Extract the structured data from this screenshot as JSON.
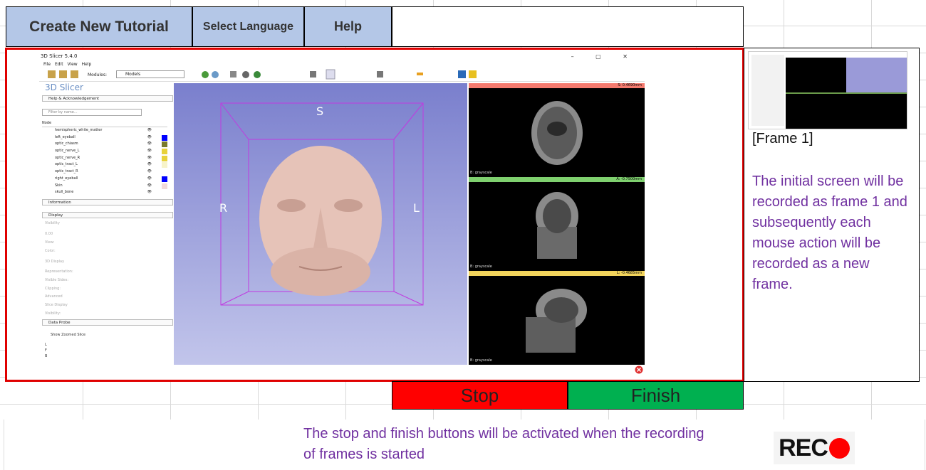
{
  "toolbar": {
    "create_label": "Create New Tutorial",
    "language_label": "Select Language",
    "help_label": "Help"
  },
  "controls": {
    "stop_label": "Stop",
    "finish_label": "Finish",
    "rec_label": "REC"
  },
  "side": {
    "frame_title": "[Frame 1]",
    "frame_description": "The initial screen will be recorded as frame 1 and subsequently each mouse action will be recorded as a new frame."
  },
  "bottom_note": "The stop and finish buttons will be activated when the recording of frames is started",
  "slicer": {
    "title": "3D Slicer 5.4.0",
    "menu": "File Edit View Help",
    "window_controls": "– ▢ ✕",
    "modules_label": "Modules:",
    "module_selected": "Models",
    "brand": "3D Slicer",
    "sections": {
      "help": "Help & Acknowledgement",
      "information": "Information",
      "display": "Display",
      "data_probe": "Data Probe"
    },
    "filter_placeholder": "Filter by name...",
    "node_header": "Node",
    "nodes": [
      {
        "name": "hemispheric_white_matter",
        "color": ""
      },
      {
        "name": "left_eyeball",
        "color": "#0000ff"
      },
      {
        "name": "optic_chiasm",
        "color": "#7a7a2a"
      },
      {
        "name": "optic_nerve_L",
        "color": "#e8d23a"
      },
      {
        "name": "optic_nerve_R",
        "color": "#e8d23a"
      },
      {
        "name": "optic_tract_L",
        "color": "#f7f3c9"
      },
      {
        "name": "optic_tract_R",
        "color": ""
      },
      {
        "name": "right_eyeball",
        "color": "#0000ff"
      },
      {
        "name": "Skin",
        "color": "#f2dada"
      },
      {
        "name": "skull_bone",
        "color": ""
      }
    ],
    "display_items": [
      "Visibility",
      "View:",
      "Color:",
      "3D Display",
      "Representation:",
      "Visible Sides:",
      "Clipping:",
      "Advanced",
      "Slice Display",
      "Visibility:"
    ],
    "opacity_value": "0.00",
    "show_zoomed_slice": "Show Zoomed Slice",
    "probe_letters": [
      "L",
      "F",
      "B"
    ],
    "orient": {
      "top": "S",
      "left": "R",
      "right": "L"
    },
    "slices": [
      {
        "bar": "S: 0.4690mm",
        "bar_color": "#f47a6e",
        "label": "B: grayscale"
      },
      {
        "bar": "A: -0.7500mm",
        "bar_color": "#7fd06f",
        "label": "B: grayscale"
      },
      {
        "bar": "L: -0.4685mm",
        "bar_color": "#f2d45c",
        "label": "B: grayscale"
      }
    ]
  }
}
